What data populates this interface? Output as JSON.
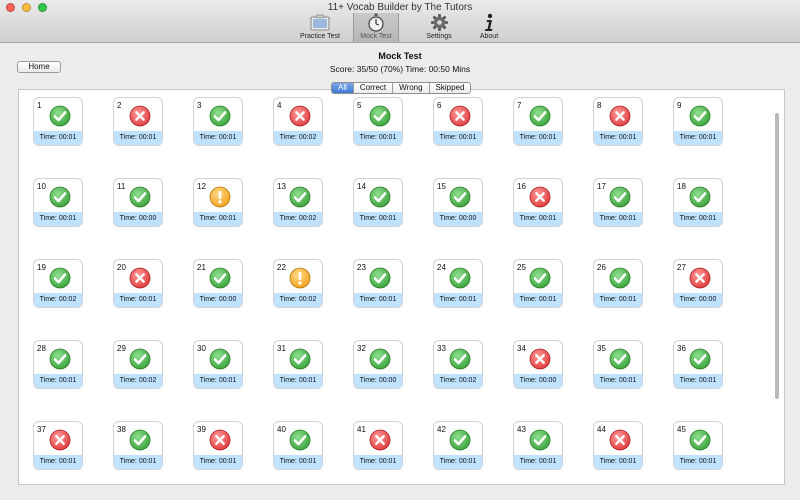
{
  "window": {
    "title": "11+ Vocab Builder by The Tutors"
  },
  "toolbar": {
    "items": [
      {
        "label": "Practice Test",
        "icon": "practice-test-icon",
        "active": false
      },
      {
        "label": "Mock Test",
        "icon": "stopwatch-icon",
        "active": true
      },
      {
        "label": "Settings",
        "icon": "gear-icon",
        "active": false
      },
      {
        "label": "About",
        "icon": "info-icon",
        "active": false
      }
    ]
  },
  "header": {
    "home_label": "Home",
    "title": "Mock Test",
    "score": "Score: 35/50 (70%) Time: 00:50 Mins"
  },
  "filters": [
    {
      "label": "All",
      "active": true
    },
    {
      "label": "Correct",
      "active": false
    },
    {
      "label": "Wrong",
      "active": false
    },
    {
      "label": "Skipped",
      "active": false
    }
  ],
  "colors": {
    "correct": "#3aa23a",
    "wrong": "#e03a3a",
    "skipped": "#f3a21a",
    "footer": "#bfe2ff",
    "accent": "#3f78d6"
  },
  "questions": [
    {
      "num": "1",
      "status": "correct",
      "time": "Time: 00:01"
    },
    {
      "num": "2",
      "status": "wrong",
      "time": "Time: 00:01"
    },
    {
      "num": "3",
      "status": "correct",
      "time": "Time: 00:01"
    },
    {
      "num": "4",
      "status": "wrong",
      "time": "Time: 00:02"
    },
    {
      "num": "5",
      "status": "correct",
      "time": "Time: 00:01"
    },
    {
      "num": "6",
      "status": "wrong",
      "time": "Time: 00:01"
    },
    {
      "num": "7",
      "status": "correct",
      "time": "Time: 00:01"
    },
    {
      "num": "8",
      "status": "wrong",
      "time": "Time: 00:01"
    },
    {
      "num": "9",
      "status": "correct",
      "time": "Time: 00:01"
    },
    {
      "num": "10",
      "status": "correct",
      "time": "Time: 00:01"
    },
    {
      "num": "11",
      "status": "correct",
      "time": "Time: 00:00"
    },
    {
      "num": "12",
      "status": "skipped",
      "time": "Time: 00:01"
    },
    {
      "num": "13",
      "status": "correct",
      "time": "Time: 00:02"
    },
    {
      "num": "14",
      "status": "correct",
      "time": "Time: 00:01"
    },
    {
      "num": "15",
      "status": "correct",
      "time": "Time: 00:00"
    },
    {
      "num": "16",
      "status": "wrong",
      "time": "Time: 00:01"
    },
    {
      "num": "17",
      "status": "correct",
      "time": "Time: 00:01"
    },
    {
      "num": "18",
      "status": "correct",
      "time": "Time: 00:01"
    },
    {
      "num": "19",
      "status": "correct",
      "time": "Time: 00:02"
    },
    {
      "num": "20",
      "status": "wrong",
      "time": "Time: 00:01"
    },
    {
      "num": "21",
      "status": "correct",
      "time": "Time: 00:00"
    },
    {
      "num": "22",
      "status": "skipped",
      "time": "Time: 00:02"
    },
    {
      "num": "23",
      "status": "correct",
      "time": "Time: 00:01"
    },
    {
      "num": "24",
      "status": "correct",
      "time": "Time: 00:01"
    },
    {
      "num": "25",
      "status": "correct",
      "time": "Time: 00:01"
    },
    {
      "num": "26",
      "status": "correct",
      "time": "Time: 00:01"
    },
    {
      "num": "27",
      "status": "wrong",
      "time": "Time: 00:00"
    },
    {
      "num": "28",
      "status": "correct",
      "time": "Time: 00:01"
    },
    {
      "num": "29",
      "status": "correct",
      "time": "Time: 00:02"
    },
    {
      "num": "30",
      "status": "correct",
      "time": "Time: 00:01"
    },
    {
      "num": "31",
      "status": "correct",
      "time": "Time: 00:01"
    },
    {
      "num": "32",
      "status": "correct",
      "time": "Time: 00:00"
    },
    {
      "num": "33",
      "status": "correct",
      "time": "Time: 00:02"
    },
    {
      "num": "34",
      "status": "wrong",
      "time": "Time: 00:00"
    },
    {
      "num": "35",
      "status": "correct",
      "time": "Time: 00:01"
    },
    {
      "num": "36",
      "status": "correct",
      "time": "Time: 00:01"
    },
    {
      "num": "37",
      "status": "wrong",
      "time": "Time: 00:01"
    },
    {
      "num": "38",
      "status": "correct",
      "time": "Time: 00:01"
    },
    {
      "num": "39",
      "status": "wrong",
      "time": "Time: 00:01"
    },
    {
      "num": "40",
      "status": "correct",
      "time": "Time: 00:01"
    },
    {
      "num": "41",
      "status": "wrong",
      "time": "Time: 00:01"
    },
    {
      "num": "42",
      "status": "correct",
      "time": "Time: 00:01"
    },
    {
      "num": "43",
      "status": "correct",
      "time": "Time: 00:01"
    },
    {
      "num": "44",
      "status": "wrong",
      "time": "Time: 00:01"
    },
    {
      "num": "45",
      "status": "correct",
      "time": "Time: 00:01"
    }
  ]
}
